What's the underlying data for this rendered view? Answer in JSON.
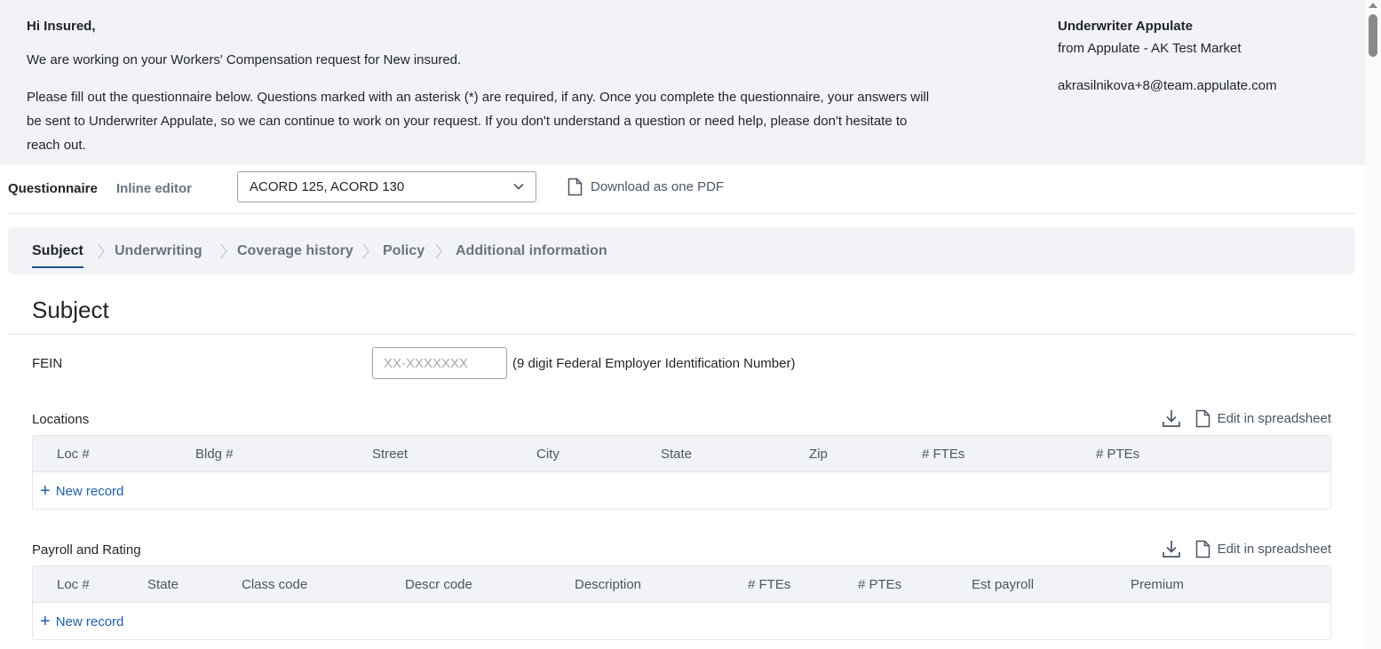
{
  "intro": {
    "greeting": "Hi Insured,",
    "working": "We are working on your Workers' Compensation request for New insured.",
    "instructions": "Please fill out the questionnaire below. Questions marked with an asterisk (*) are required, if any. Once you complete the questionnaire, your answers will be sent to Underwriter Appulate, so we can continue to work on your request. If you don't understand a question or need help, please don't hesitate to reach out."
  },
  "underwriter": {
    "name": "Underwriter Appulate",
    "from": "from Appulate - AK Test Market",
    "email": "akrasilnikova+8@team.appulate.com"
  },
  "toolbar": {
    "tab_questionnaire": "Questionnaire",
    "tab_inline_editor": "Inline editor",
    "form_select_value": "ACORD 125, ACORD 130",
    "download_label": "Download as one PDF"
  },
  "steps": [
    "Subject",
    "Underwriting",
    "Coverage history",
    "Policy",
    "Additional information"
  ],
  "active_step": "Subject",
  "section": {
    "title": "Subject",
    "fein_label": "FEIN",
    "fein_placeholder": "XX-XXXXXXX",
    "fein_hint": "(9 digit Federal Employer Identification Number)"
  },
  "locations": {
    "title": "Locations",
    "edit_label": "Edit in spreadsheet",
    "columns": [
      "Loc #",
      "Bldg #",
      "Street",
      "City",
      "State",
      "Zip",
      "# FTEs",
      "# PTEs"
    ],
    "new_record": "New record"
  },
  "payroll": {
    "title": "Payroll and Rating",
    "edit_label": "Edit in spreadsheet",
    "columns": [
      "Loc #",
      "State",
      "Class code",
      "Descr code",
      "Description",
      "# FTEs",
      "# PTEs",
      "Est payroll",
      "Premium"
    ],
    "new_record": "New record"
  },
  "colors": {
    "panel_bg": "#f1f3f7",
    "link": "#1f5fa8",
    "active_underline": "#1f4e8c"
  }
}
